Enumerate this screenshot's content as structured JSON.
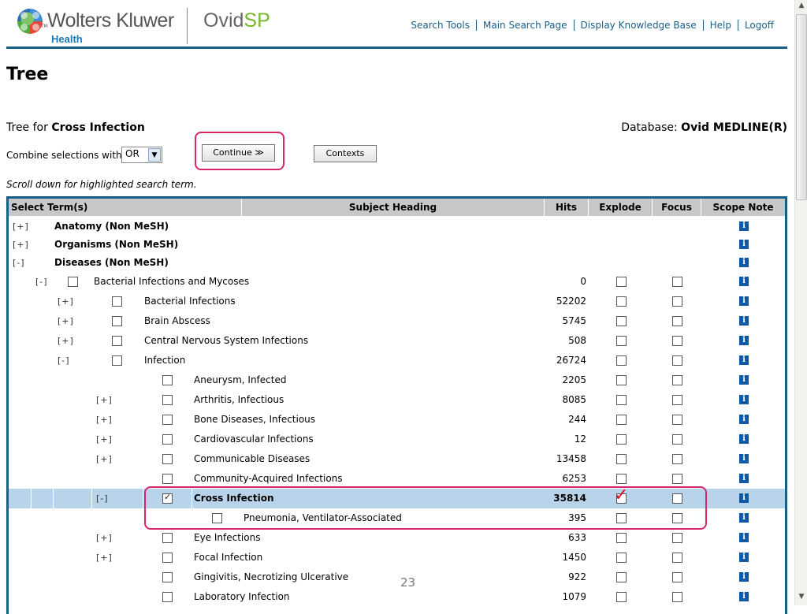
{
  "header": {
    "brand": "Wolters Kluwer",
    "brand_sub": "Health",
    "tm": "TM",
    "product_main": "Ovid",
    "product_sp": "SP",
    "nav": [
      "Search Tools",
      "Main Search Page",
      "Display Knowledge Base",
      "Help",
      "Logoff"
    ]
  },
  "page_title": "Tree",
  "tree_for": {
    "label": "Tree for",
    "term": "Cross Infection"
  },
  "database": {
    "label": "Database:",
    "name": "Ovid MEDLINE(R)"
  },
  "combine": {
    "label": "Combine selections with:",
    "value": "OR"
  },
  "buttons": {
    "continue": "Continue ≫",
    "contexts": "Contexts"
  },
  "scroll_note": "Scroll down for highlighted search term.",
  "columns": [
    "Select Term(s)",
    "Subject Heading",
    "Hits",
    "Explode",
    "Focus",
    "Scope Note"
  ],
  "rows": [
    {
      "toggle": "[+]",
      "label": "Anatomy (Non MeSH)",
      "hits": "",
      "bold": true
    },
    {
      "toggle": "[+]",
      "label": "Organisms (Non MeSH)",
      "hits": "",
      "bold": true
    },
    {
      "toggle": "[-]",
      "label": "Diseases (Non MeSH)",
      "hits": "",
      "bold": true
    },
    {
      "toggle": "[-]",
      "label": "Bacterial Infections and Mycoses",
      "hits": "0"
    },
    {
      "toggle": "[+]",
      "label": "Bacterial Infections",
      "hits": "52202"
    },
    {
      "toggle": "[+]",
      "label": "Brain Abscess",
      "hits": "5745"
    },
    {
      "toggle": "[+]",
      "label": "Central Nervous System Infections",
      "hits": "508"
    },
    {
      "toggle": "[-]",
      "label": "Infection",
      "hits": "26724"
    },
    {
      "toggle": "",
      "label": "Aneurysm, Infected",
      "hits": "2205"
    },
    {
      "toggle": "[+]",
      "label": "Arthritis, Infectious",
      "hits": "8085"
    },
    {
      "toggle": "[+]",
      "label": "Bone Diseases, Infectious",
      "hits": "244"
    },
    {
      "toggle": "[+]",
      "label": "Cardiovascular Infections",
      "hits": "12"
    },
    {
      "toggle": "[+]",
      "label": "Communicable Diseases",
      "hits": "13458"
    },
    {
      "toggle": "",
      "label": "Community-Acquired Infections",
      "hits": "6253"
    },
    {
      "toggle": "[-]",
      "label": "Cross Infection",
      "hits": "35814",
      "bold": true,
      "highlight": true,
      "checked": true,
      "explode_checked": true
    },
    {
      "toggle": "",
      "label": "Pneumonia, Ventilator-Associated",
      "hits": "395"
    },
    {
      "toggle": "[+]",
      "label": "Eye Infections",
      "hits": "633"
    },
    {
      "toggle": "[+]",
      "label": "Focal Infection",
      "hits": "1450"
    },
    {
      "toggle": "",
      "label": "Gingivitis, Necrotizing Ulcerative",
      "hits": "922"
    },
    {
      "toggle": "",
      "label": "Laboratory Infection",
      "hits": "1079"
    }
  ],
  "page_number": "23",
  "colors": {
    "accent": "#1a5e87",
    "highlight_row": "#b9d3ea",
    "annotation": "#d6246e",
    "check_mark": "#e0101a"
  }
}
